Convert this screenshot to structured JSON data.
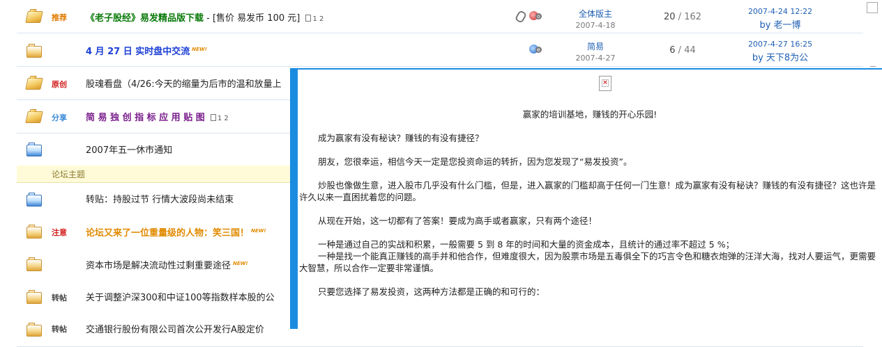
{
  "forum": {
    "section_label": "论坛主题",
    "rows": [
      {
        "badge": "推荐",
        "badge_color": "#e07b00",
        "prefix": "《老子股经》易发精品版下载",
        "suffix": " - [售价 易发币 100 元]",
        "title_color": "#0a7a0a",
        "pages": "1 2",
        "author": "全体版主",
        "date": "2007-4-18",
        "reply": "20",
        "views": "162",
        "last_time": "2007-4-24 12:22",
        "last_by": "by 老一博"
      },
      {
        "badge": "",
        "prefix": "4 月 27 日 实时盘中交流",
        "title_color": "#1c3fd6",
        "new": "NEW!",
        "author": "简易",
        "date": "2007-4-27",
        "reply": "6",
        "views": "44",
        "last_time": "2007-4-27 16:25",
        "last_by": "by 天下8为公"
      },
      {
        "badge": "原创",
        "badge_color": "#d32020",
        "prefix": "股魂看盘（4/26:今天的缩量为后市的温和放量上",
        "title_color": "#222"
      },
      {
        "badge": "分享",
        "badge_color": "#3a8ad8",
        "prefix": "简 易 独 创 指 标 应 用 贴 图",
        "title_color": "#7a1e8c",
        "pages": "1 2"
      },
      {
        "badge": "",
        "prefix": "2007年五一休市通知",
        "title_color": "#222"
      },
      {
        "badge": "",
        "prefix": "转贴：持股过节 行情大波段尚未结束",
        "title_color": "#222"
      },
      {
        "badge": "注意",
        "badge_color": "#d32020",
        "prefix": "论坛又来了一位重量级的人物：笑三国！",
        "title_color": "#e08a00",
        "new": "NEW!"
      },
      {
        "badge": "",
        "prefix": "资本市场是解决流动性过剩重要途径",
        "title_color": "#222",
        "new": "NEW!"
      },
      {
        "badge": "转帖",
        "badge_color": "#444",
        "prefix": "关于调整沪深300和中证100等指数样本股的公",
        "title_color": "#222"
      },
      {
        "badge": "转帖",
        "badge_color": "#444",
        "prefix": "交通银行股份有限公司首次公开发行A股定价",
        "title_color": "#222"
      }
    ]
  },
  "popup": {
    "close_icon": "close-icon",
    "paragraphs": [
      "赢家的培训基地，赚钱的开心乐园!",
      "成为赢家有没有秘诀？赚钱的有没有捷径？",
      "朋友，您很幸运，相信今天一定是您投资命运的转折，因为您发现了“易发投资”。",
      "炒股也像做生意，进入股市几乎没有什么门槛，但是，进入赢家的门槛却高于任何一门生意！成为赢家有没有秘诀？赚钱的有没有捷径？这也许是许久以来一直困扰着您的问题。",
      "从现在开始，这一切都有了答案！要成为高手或者赢家，只有两个途径！",
      "一种是通过自己的实战和积累，一般需要 5 到 8 年的时间和大量的资金成本，且统计的通过率不超过 5 %；",
      "一种是找一个能真正赚钱的高手并和他合作，但难度很大，因为股票市场是五毒俱全下的巧言令色和糖衣炮弹的汪洋大海，找对人要运气，更需要大智慧，所以合作一定要非常谨慎。",
      "只要您选择了易发投资，这两种方法都是正确的和可行的："
    ]
  }
}
